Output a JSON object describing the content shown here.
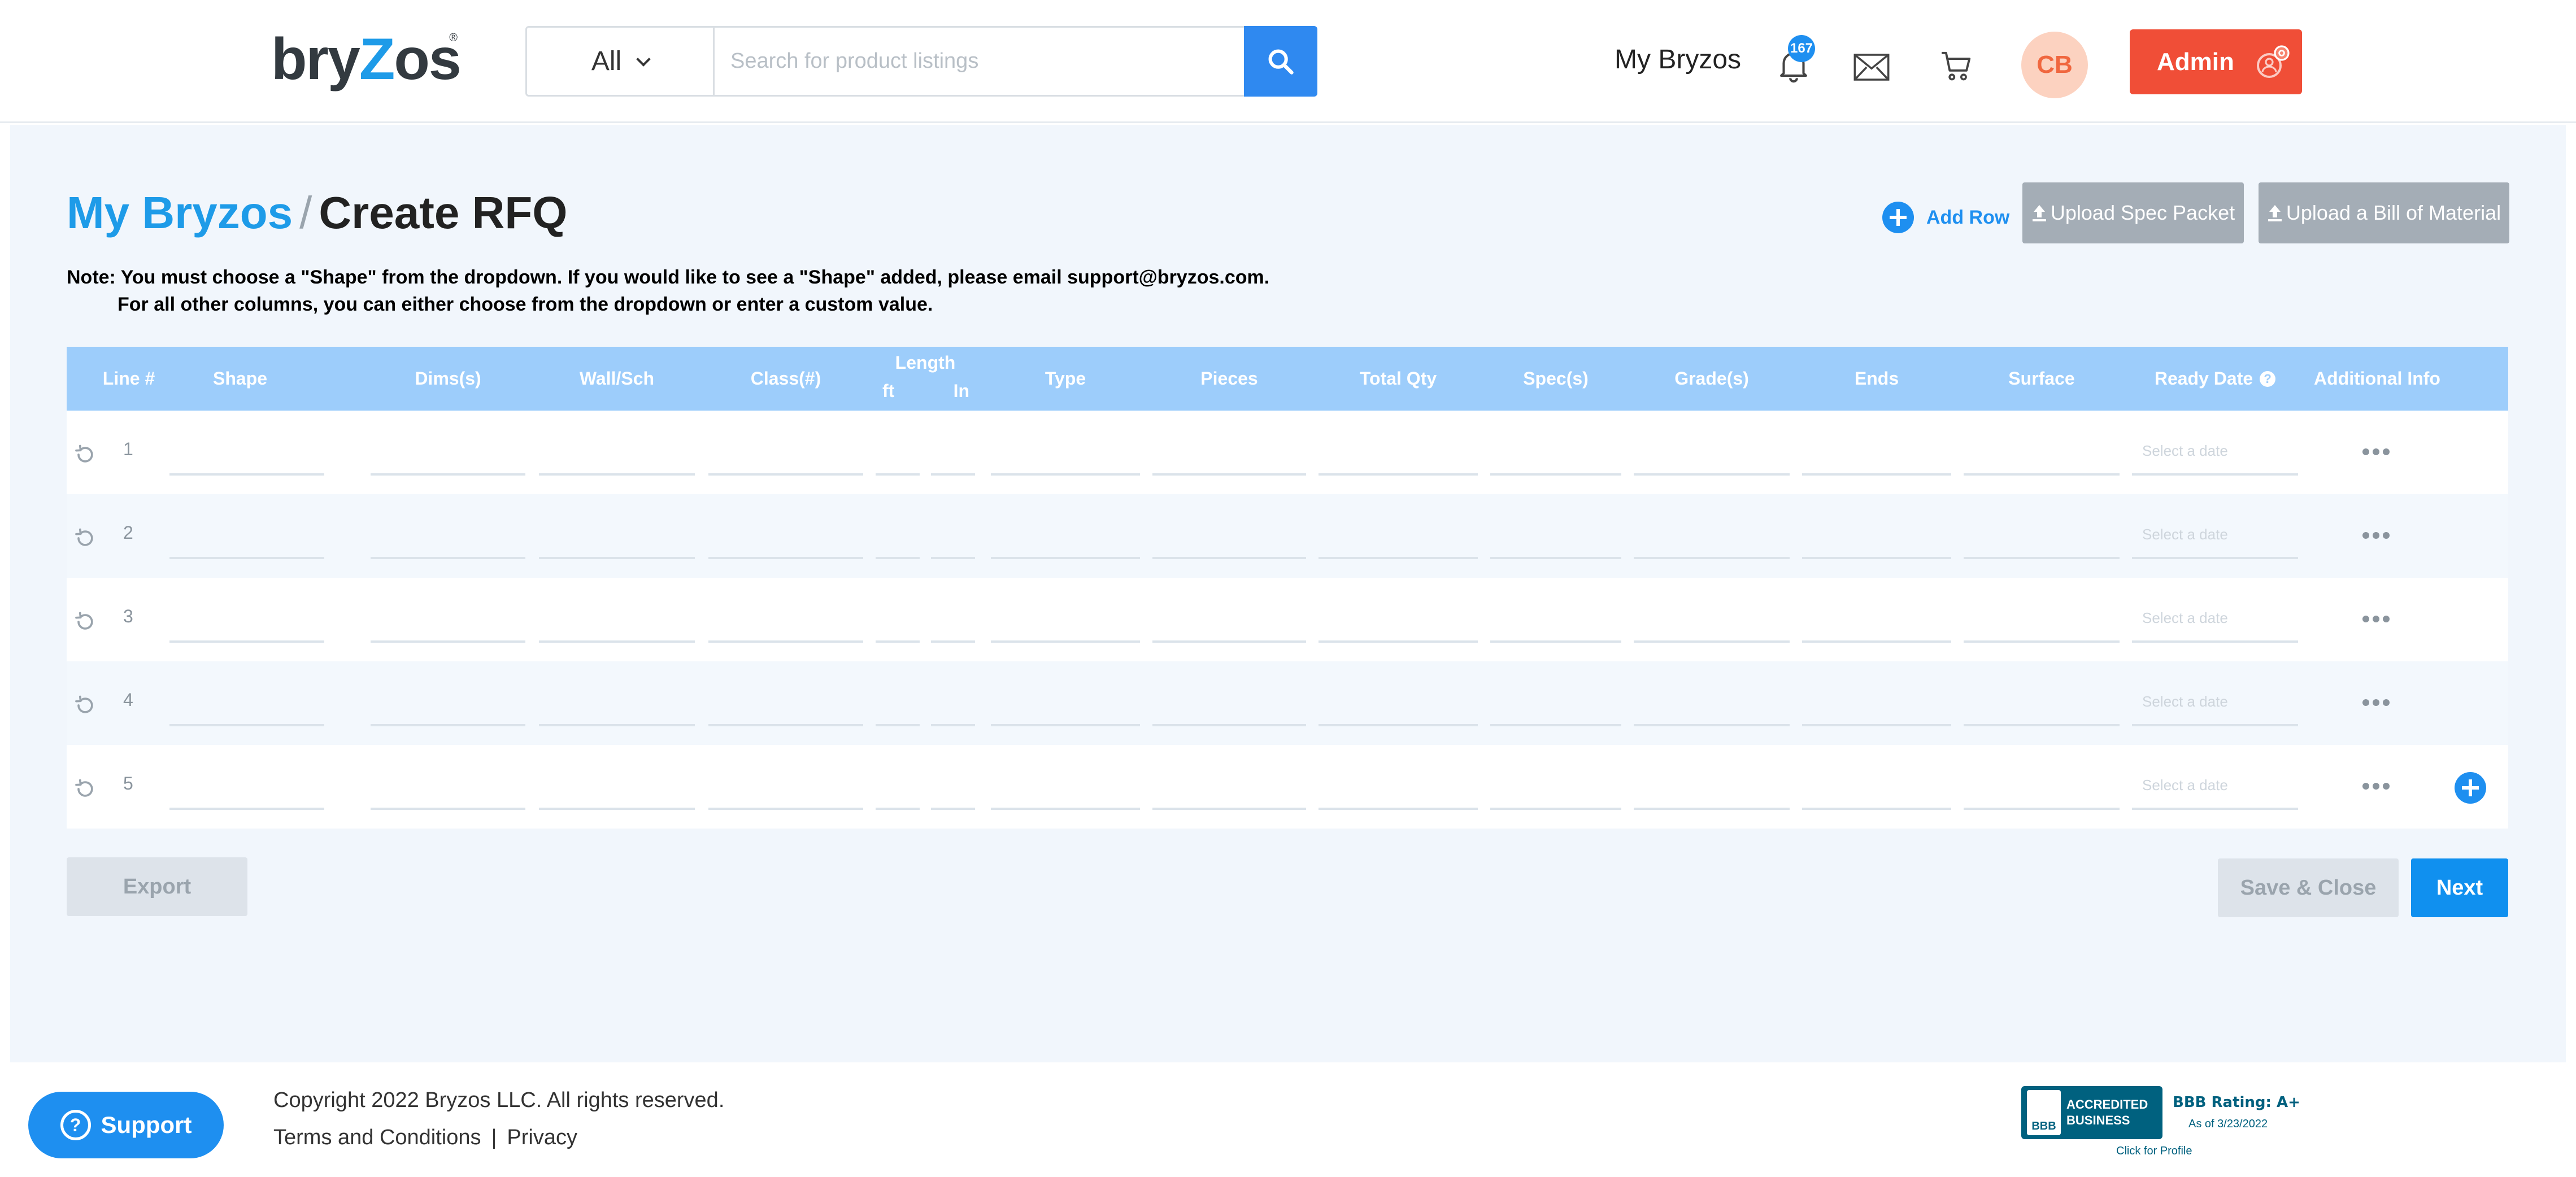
{
  "header": {
    "logo_text_a": "bry",
    "logo_text_z": "Z",
    "logo_text_b": "os",
    "logo_reg": "®",
    "category": "All",
    "search_placeholder": "Search for product listings",
    "my_bryzos": "My Bryzos",
    "notification_count": "167",
    "avatar_initials": "CB",
    "admin_label": "Admin"
  },
  "page": {
    "breadcrumb_root": "My Bryzos",
    "breadcrumb_sep": "/",
    "title": "Create RFQ",
    "add_row": "Add Row",
    "upload_spec": "Upload Spec Packet",
    "upload_bom": "Upload a Bill of Material",
    "note_line1": "Note: You must choose a \"Shape\" from the dropdown. If you would like to see a \"Shape\" added, please email support@bryzos.com.",
    "note_line2": "For all other columns, you can either choose from the dropdown or enter a custom value."
  },
  "table": {
    "headers": {
      "line": "Line #",
      "shape": "Shape",
      "dims": "Dims(s)",
      "wall": "Wall/Sch",
      "class": "Class(#)",
      "length": "Length",
      "length_ft": "ft",
      "length_in": "In",
      "type": "Type",
      "pieces": "Pieces",
      "total_qty": "Total Qty",
      "specs": "Spec(s)",
      "grades": "Grade(s)",
      "ends": "Ends",
      "surface": "Surface",
      "ready_date": "Ready Date",
      "help": "?",
      "additional": "Additional Info"
    },
    "rows": [
      {
        "line": "1",
        "date_placeholder": "Select a date"
      },
      {
        "line": "2",
        "date_placeholder": "Select a date"
      },
      {
        "line": "3",
        "date_placeholder": "Select a date"
      },
      {
        "line": "4",
        "date_placeholder": "Select a date"
      },
      {
        "line": "5",
        "date_placeholder": "Select a date"
      }
    ]
  },
  "actions": {
    "export": "Export",
    "save_close": "Save & Close",
    "next": "Next"
  },
  "footer": {
    "support": "Support",
    "support_icon": "?",
    "copyright": "Copyright 2022 Bryzos LLC. All rights reserved.",
    "terms": "Terms and Conditions",
    "link_sep": "|",
    "privacy": "Privacy",
    "bbb_logo": "BBB",
    "bbb_accredited": "ACCREDITED",
    "bbb_business": "BUSINESS",
    "bbb_rating": "BBB Rating: A+",
    "bbb_asof": "As of 3/23/2022",
    "bbb_click": "Click for Profile"
  },
  "colors": {
    "brand_blue": "#1e9be8",
    "primary_button": "#1090ef",
    "admin_red": "#f04e37",
    "table_header": "#9dcdfb",
    "bbb_teal": "#00617f"
  }
}
